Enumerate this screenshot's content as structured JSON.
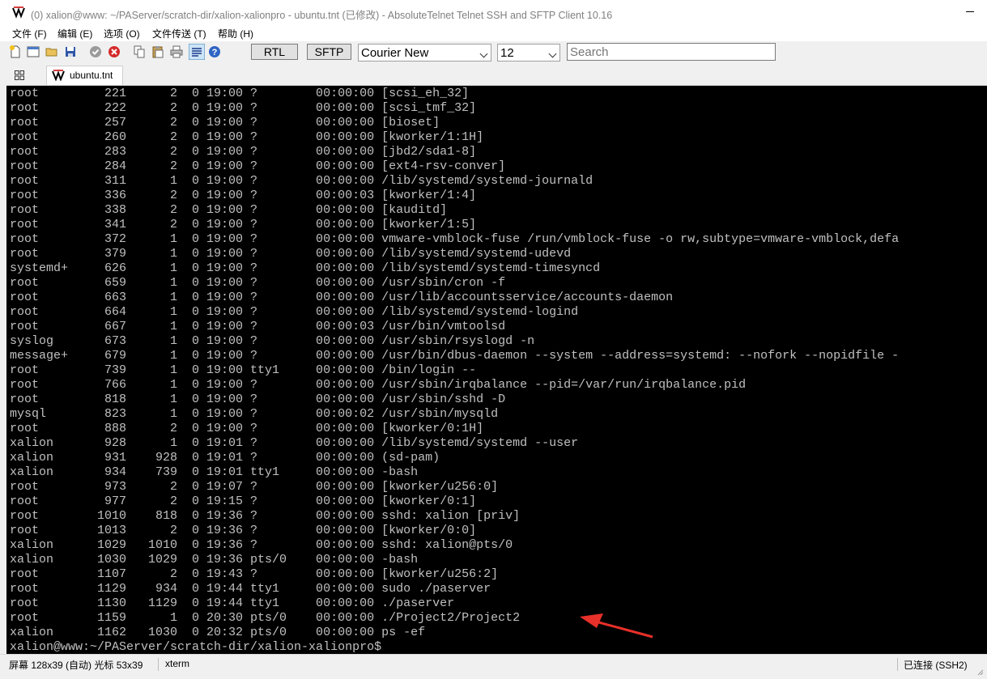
{
  "window": {
    "title": "(0) xalion@www: ~/PAServer/scratch-dir/xalion-xalionpro - ubuntu.tnt (已修改) - AbsoluteTelnet Telnet SSH and SFTP Client 10.16"
  },
  "menu": {
    "file": "文件 (F)",
    "edit": "编辑 (E)",
    "options": "选项 (O)",
    "transfer": "文件传送 (T)",
    "help": "帮助 (H)"
  },
  "toolbar": {
    "rtl_label": "RTL",
    "sftp_label": "SFTP",
    "font_name": "Courier New",
    "font_size": "12",
    "search_placeholder": "Search",
    "icons": [
      "new-icon",
      "new-window-icon",
      "open-folder-icon",
      "save-icon",
      "connect-icon",
      "disconnect-icon",
      "copy-icon",
      "paste-icon",
      "print-icon",
      "highlight-icon",
      "help-icon"
    ]
  },
  "tabs": [
    {
      "label": "ubuntu.tnt"
    }
  ],
  "terminal": {
    "colors": {
      "background": "#000000",
      "foreground": "#c0c0c0"
    },
    "lines": [
      "root         221      2  0 19:00 ?        00:00:00 [scsi_eh_32]",
      "root         222      2  0 19:00 ?        00:00:00 [scsi_tmf_32]",
      "root         257      2  0 19:00 ?        00:00:00 [bioset]",
      "root         260      2  0 19:00 ?        00:00:00 [kworker/1:1H]",
      "root         283      2  0 19:00 ?        00:00:00 [jbd2/sda1-8]",
      "root         284      2  0 19:00 ?        00:00:00 [ext4-rsv-conver]",
      "root         311      1  0 19:00 ?        00:00:00 /lib/systemd/systemd-journald",
      "root         336      2  0 19:00 ?        00:00:03 [kworker/1:4]",
      "root         338      2  0 19:00 ?        00:00:00 [kauditd]",
      "root         341      2  0 19:00 ?        00:00:00 [kworker/1:5]",
      "root         372      1  0 19:00 ?        00:00:00 vmware-vmblock-fuse /run/vmblock-fuse -o rw,subtype=vmware-vmblock,defa",
      "root         379      1  0 19:00 ?        00:00:00 /lib/systemd/systemd-udevd",
      "systemd+     626      1  0 19:00 ?        00:00:00 /lib/systemd/systemd-timesyncd",
      "root         659      1  0 19:00 ?        00:00:00 /usr/sbin/cron -f",
      "root         663      1  0 19:00 ?        00:00:00 /usr/lib/accountsservice/accounts-daemon",
      "root         664      1  0 19:00 ?        00:00:00 /lib/systemd/systemd-logind",
      "root         667      1  0 19:00 ?        00:00:03 /usr/bin/vmtoolsd",
      "syslog       673      1  0 19:00 ?        00:00:00 /usr/sbin/rsyslogd -n",
      "message+     679      1  0 19:00 ?        00:00:00 /usr/bin/dbus-daemon --system --address=systemd: --nofork --nopidfile -",
      "root         739      1  0 19:00 tty1     00:00:00 /bin/login --",
      "root         766      1  0 19:00 ?        00:00:00 /usr/sbin/irqbalance --pid=/var/run/irqbalance.pid",
      "root         818      1  0 19:00 ?        00:00:00 /usr/sbin/sshd -D",
      "mysql        823      1  0 19:00 ?        00:00:02 /usr/sbin/mysqld",
      "root         888      2  0 19:00 ?        00:00:00 [kworker/0:1H]",
      "xalion       928      1  0 19:01 ?        00:00:00 /lib/systemd/systemd --user",
      "xalion       931    928  0 19:01 ?        00:00:00 (sd-pam)",
      "xalion       934    739  0 19:01 tty1     00:00:00 -bash",
      "root         973      2  0 19:07 ?        00:00:00 [kworker/u256:0]",
      "root         977      2  0 19:15 ?        00:00:00 [kworker/0:1]",
      "root        1010    818  0 19:36 ?        00:00:00 sshd: xalion [priv]",
      "root        1013      2  0 19:36 ?        00:00:00 [kworker/0:0]",
      "xalion      1029   1010  0 19:36 ?        00:00:00 sshd: xalion@pts/0",
      "xalion      1030   1029  0 19:36 pts/0    00:00:00 -bash",
      "root        1107      2  0 19:43 ?        00:00:00 [kworker/u256:2]",
      "root        1129    934  0 19:44 tty1     00:00:00 sudo ./paserver",
      "root        1130   1129  0 19:44 tty1     00:00:00 ./paserver",
      "root        1159      1  0 20:30 pts/0    00:00:00 ./Project2/Project2",
      "xalion      1162   1030  0 20:32 pts/0    00:00:00 ps -ef",
      "xalion@www:~/PAServer/scratch-dir/xalion-xalionpro$"
    ]
  },
  "annotation": {
    "color": "#e8302a",
    "points_to": "./Project2/Project2"
  },
  "status": {
    "screen_info": "屏幕 128x39 (自动) 光标 53x39",
    "terminal_type": "xterm",
    "connection": "已连接 (SSH2)"
  }
}
